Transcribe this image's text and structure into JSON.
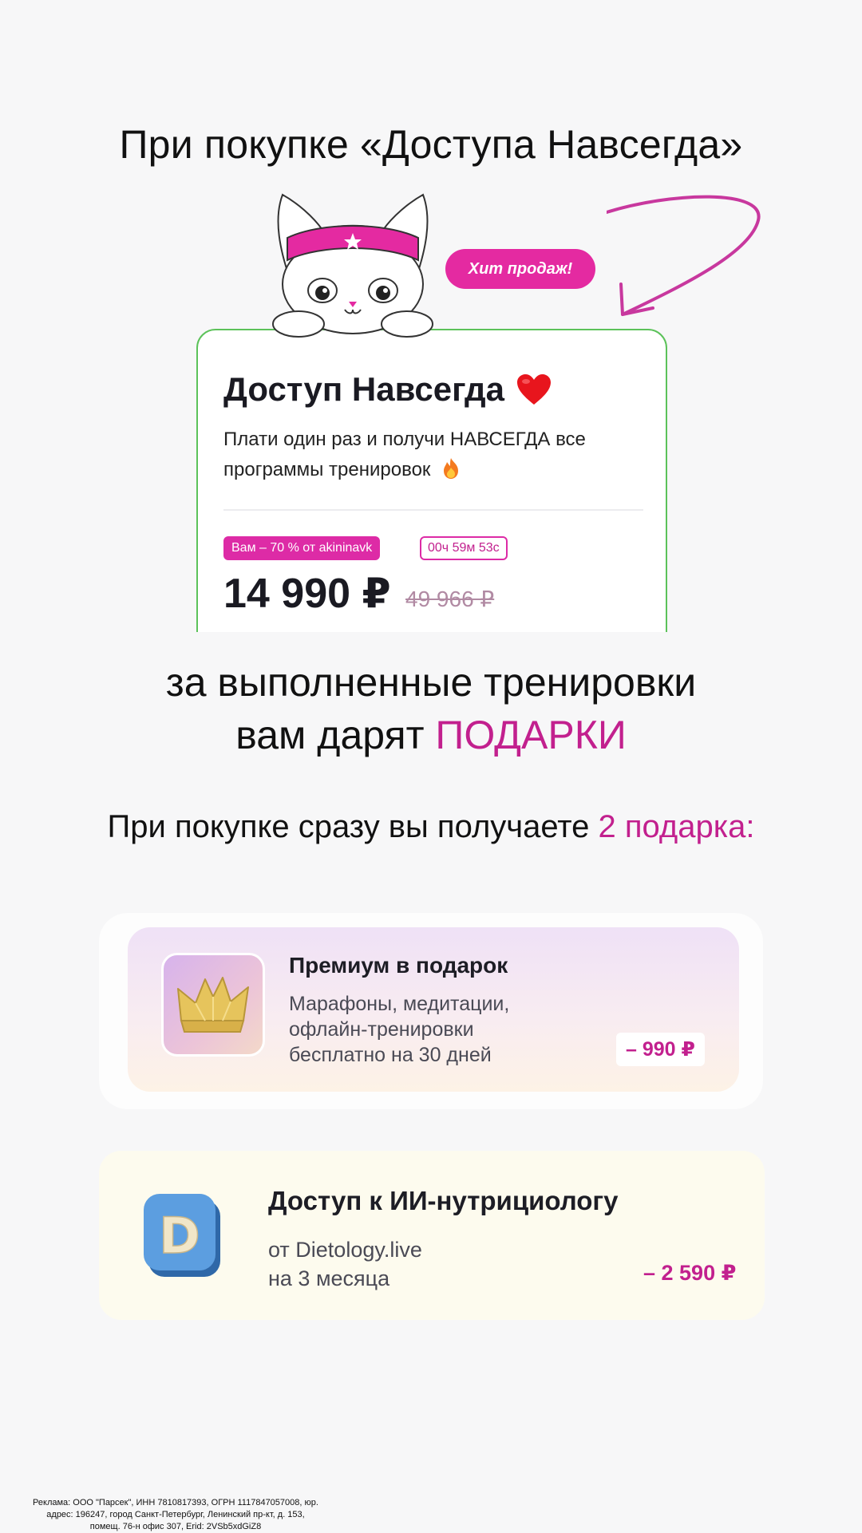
{
  "headline_top": "При покупке «Доступа Навсегда»",
  "hit_badge": "Хит продаж!",
  "product": {
    "title": "Доступ Навсегда",
    "title_icon": "heart-icon",
    "subtitle": "Плати один раз и получи НАВСЕГДА все программы тренировок",
    "subtitle_icon": "fire-icon",
    "promo": "Вам – 70 % от akininavk",
    "timer": "00ч 59м 53с",
    "price": "14 990 ₽",
    "old_price": "49 966 ₽"
  },
  "headline_middle": {
    "line1": "за выполненные тренировки",
    "line2_prefix": "вам дарят ",
    "line2_highlight": "ПОДАРКИ"
  },
  "headline_gifts": {
    "prefix": "При покупке сразу вы получаете ",
    "highlight": "2 подарка:"
  },
  "gifts": [
    {
      "icon": "crown-icon",
      "title": "Премиум в подарок",
      "line1": "Марафоны, медитации,",
      "line2": "офлайн-тренировки",
      "line3": "бесплатно на 30 дней",
      "price": "– 990 ₽"
    },
    {
      "icon": "dietology-d-icon",
      "icon_letter": "D",
      "title": "Доступ к ИИ-нутрициологу",
      "line1": "от Dietology.live",
      "line2": "на 3 месяца",
      "price": "– 2 590 ₽"
    }
  ],
  "disclaimer": {
    "line1": "Реклама: ООО \"Парсек\", ИНН 7810817393, ОГРН 1117847057008, юр.",
    "line2": "адрес: 196247, город Санкт-Петербург, Ленинский пр-кт, д. 153,",
    "line3": "помещ. 76-н офис 307, Erid: 2VSb5xdGiZ8"
  },
  "colors": {
    "accent_pink": "#dd2ba6",
    "card_border_green": "#5cc25a",
    "background": "#f7f7f8"
  }
}
